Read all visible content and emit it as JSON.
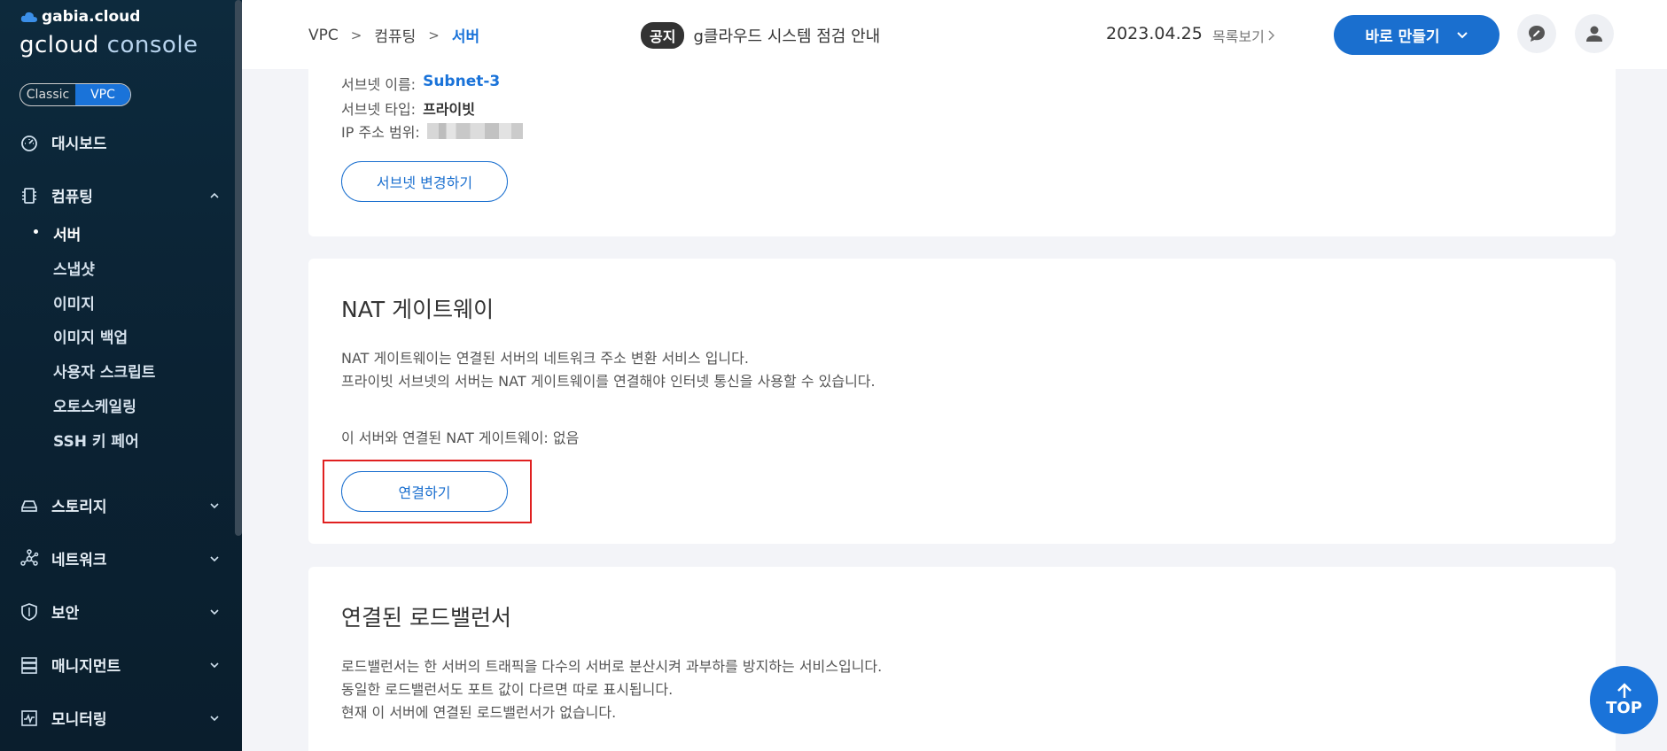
{
  "sidebar": {
    "brand_small": "gabia.cloud",
    "brand_big_1": "gcloud",
    "brand_big_2": " console",
    "env": {
      "classic": "Classic",
      "vpc": "VPC"
    },
    "items": [
      {
        "label": "대시보드",
        "icon": "dashboard-icon"
      },
      {
        "label": "컴퓨팅",
        "icon": "chip-icon"
      },
      {
        "label": "스토리지",
        "icon": "storage-icon"
      },
      {
        "label": "네트워크",
        "icon": "network-icon"
      },
      {
        "label": "보안",
        "icon": "shield-icon"
      },
      {
        "label": "매니지먼트",
        "icon": "management-icon"
      },
      {
        "label": "모니터링",
        "icon": "monitoring-icon"
      }
    ],
    "sub_items": [
      "서버",
      "스냅샷",
      "이미지",
      "이미지 백업",
      "사용자 스크립트",
      "오토스케일링",
      "SSH 키 페어"
    ]
  },
  "topbar": {
    "breadcrumb": [
      "VPC",
      "컴퓨팅",
      "서버"
    ],
    "notice_badge": "공지",
    "notice_text": "g클라우드 시스템 점검 안내",
    "notice_date": "2023.04.25",
    "notice_more": "목록보기",
    "create_label": "바로 만들기"
  },
  "subnet_card": {
    "name_label": "서브넷 이름:",
    "name_value": "Subnet-3",
    "type_label": "서브넷 타입:",
    "type_value": "프라이빗",
    "ip_label": "IP 주소 범위:",
    "change_button": "서브넷 변경하기"
  },
  "nat_card": {
    "title": "NAT 게이트웨이",
    "desc_1": "NAT 게이트웨이는 연결된 서버의 네트워크 주소 변환 서비스 입니다.",
    "desc_2": "프라이빗 서브넷의 서버는 NAT 게이트웨이를 연결해야 인터넷 통신을 사용할 수 있습니다.",
    "status": "이 서버와 연결된 NAT 게이트웨이: 없음",
    "connect_button": "연결하기"
  },
  "lb_card": {
    "title": "연결된 로드밸런서",
    "desc_1": "로드밸런서는 한 서버의 트래픽을 다수의 서버로 분산시켜 과부하를 방지하는 서비스입니다.",
    "desc_2": "동일한 로드밸런서도 포트 값이 다르면 따로 표시됩니다.",
    "desc_3": "현재 이 서버에 연결된 로드밸런서가 없습니다."
  },
  "top_button": "TOP",
  "colors": {
    "accent": "#1a73d9",
    "sidebar_bg": "#0d2a3d",
    "highlight": "#e02020"
  }
}
